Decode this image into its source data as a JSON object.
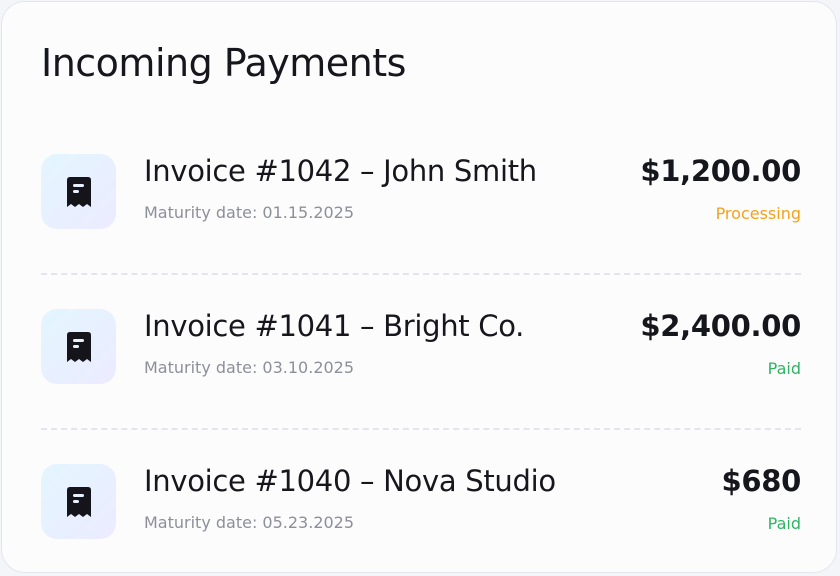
{
  "card": {
    "title": "Incoming Payments"
  },
  "invoices": [
    {
      "title": "Invoice #1042 – John Smith",
      "maturity": "Maturity date: 01.15.2025",
      "amount": "$1,200.00",
      "status": "Processing",
      "status_color": "#f4a11c",
      "icon": "receipt-icon"
    },
    {
      "title": "Invoice #1041 – Bright Co.",
      "maturity": "Maturity date: 03.10.2025",
      "amount": "$2,400.00",
      "status": "Paid",
      "status_color": "#2fb464",
      "icon": "receipt-icon"
    },
    {
      "title": "Invoice #1040 – Nova Studio",
      "maturity": "Maturity date: 05.23.2025",
      "amount": "$680",
      "status": "Paid",
      "status_color": "#2fb464",
      "icon": "receipt-icon"
    }
  ],
  "colors": {
    "card_background": "#fcfcfd",
    "text_primary": "#16161d",
    "text_secondary": "#8d8f99",
    "icon_tile_from": "#e3f6ff",
    "icon_tile_to": "#ecebff",
    "divider": "#e3e4ee"
  }
}
